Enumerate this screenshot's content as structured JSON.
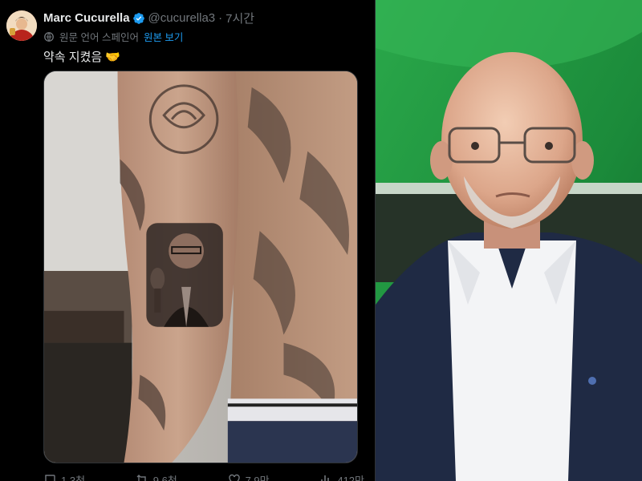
{
  "tweet": {
    "author": {
      "display_name": "Marc Cucurella",
      "handle": "@cucurella3",
      "avatar_icon": "avatar-photo",
      "verified_icon": "verified-badge-icon",
      "verified_color": "#1d9bf0"
    },
    "separator": "·",
    "timestamp": "7시간",
    "translation": {
      "icon": "translate-icon",
      "note": "원문 언어 스페인어",
      "show_original_label": "원본 보기"
    },
    "text": "약속 지켰음",
    "text_emoji": "🤝",
    "media": {
      "description_icon": "tattoo-photo"
    },
    "actions": {
      "reply_count": "1.3천",
      "retweet_count": "9.6천",
      "like_count": "7.9만",
      "views_count": "412만"
    }
  },
  "colors": {
    "background": "#000000",
    "primary_text": "#e7e9ea",
    "secondary_text": "#71767b",
    "accent": "#1d9bf0"
  },
  "photo": {
    "icon": "coach-photo",
    "background_color": "#1f8a3c"
  }
}
